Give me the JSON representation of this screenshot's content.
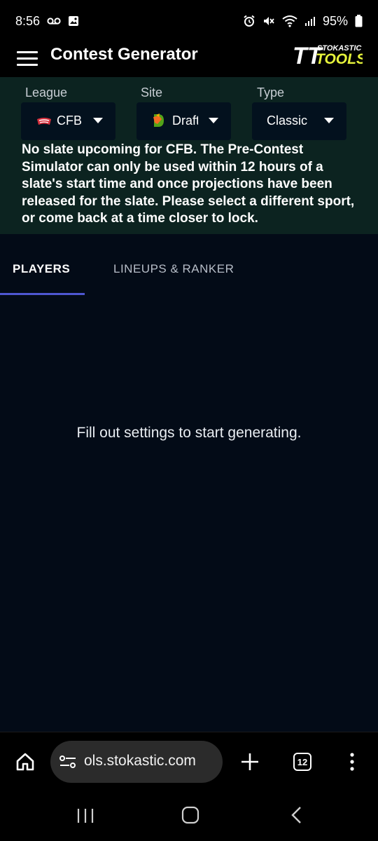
{
  "status_bar": {
    "time": "8:56",
    "battery": "95%",
    "left_icons": [
      "voicemail-icon",
      "image-icon"
    ],
    "right_icons": [
      "alarm-icon",
      "mute-icon",
      "wifi-icon",
      "signal-icon",
      "battery-icon"
    ]
  },
  "app_bar": {
    "title": "Contest Generator",
    "brand": {
      "mark": "TT",
      "line1": "STOKASTIC",
      "line2": "TOOLS",
      "accent_color": "#e6f33b"
    }
  },
  "settings": {
    "league": {
      "label": "League",
      "value": "CFB"
    },
    "site": {
      "label": "Site",
      "value": "Draft"
    },
    "type": {
      "label": "Type",
      "value": "Classic"
    },
    "notice": "No slate upcoming for CFB. The Pre-Contest Simulator can only be used within 12 hours of a slate's start time and once projections have been released for the slate. Please select a different sport, or come back at a time closer to lock."
  },
  "tabs": [
    {
      "label": "PLAYERS",
      "active": true
    },
    {
      "label": "LINEUPS & RANKER",
      "active": false
    }
  ],
  "main": {
    "empty_message": "Fill out settings to start generating."
  },
  "browser": {
    "url": "ols.stokastic.com",
    "tab_count": "12"
  },
  "colors": {
    "settings_bg": "#0c2320",
    "content_bg": "#030b17",
    "tab_indicator": "#4e57d1",
    "select_bg": "#03111e"
  }
}
